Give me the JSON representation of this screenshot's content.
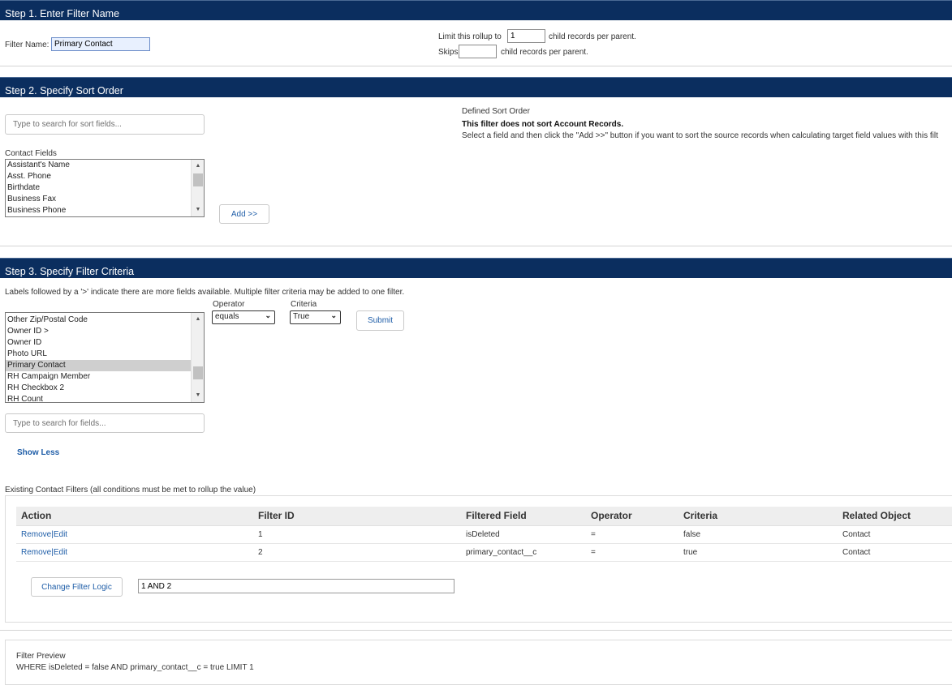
{
  "step1": {
    "title": "Step 1. Enter Filter Name",
    "filter_name_label": "Filter Name:",
    "filter_name_value": "Primary Contact",
    "limit_label": "Limit this rollup to",
    "limit_value": "1",
    "limit_suffix": "child records per parent.",
    "skips_label": "Skips",
    "skips_value": "",
    "skips_suffix": "child records per parent."
  },
  "step2": {
    "title": "Step 2. Specify Sort Order",
    "search_placeholder": "Type to search for sort fields...",
    "list_label": "Contact Fields",
    "fields": [
      "Assistant's Name",
      "Asst. Phone",
      "Birthdate",
      "Business Fax",
      "Business Phone"
    ],
    "add_button": "Add >>",
    "defined_sort_label": "Defined Sort Order",
    "no_sort_msg": "This filter does not sort Account Records.",
    "instructions": "Select a field and then click the \"Add >>\" button if you want to sort the source records when calculating target field values with this filt"
  },
  "step3": {
    "title": "Step 3. Specify Filter Criteria",
    "note": "Labels followed by a '>' indicate there are more fields available. Multiple filter criteria may be added to one filter.",
    "fields": [
      "Other Zip/Postal Code",
      "Owner ID >",
      "Owner ID",
      "Photo URL",
      "Primary Contact",
      "RH Campaign Member",
      "RH Checkbox 2",
      "RH Count"
    ],
    "selected_field": "Primary Contact",
    "operator_label": "Operator",
    "operator_value": "equals",
    "criteria_label": "Criteria",
    "criteria_value": "True",
    "submit_button": "Submit",
    "search_placeholder": "Type to search for fields...",
    "show_less": "Show Less",
    "existing_label": "Existing Contact Filters (all conditions must be met to rollup the value)",
    "table": {
      "columns": [
        "Action",
        "Filter ID",
        "Filtered Field",
        "Operator",
        "Criteria",
        "Related Object"
      ],
      "rows": [
        {
          "action": "Remove|Edit",
          "id": "1",
          "field": "isDeleted",
          "operator": "=",
          "criteria": "false",
          "object": "Contact"
        },
        {
          "action": "Remove|Edit",
          "id": "2",
          "field": "primary_contact__c",
          "operator": "=",
          "criteria": "true",
          "object": "Contact"
        }
      ]
    },
    "change_logic_button": "Change Filter Logic",
    "logic_value": "1 AND 2"
  },
  "preview": {
    "label": "Filter Preview",
    "query": "WHERE isDeleted = false AND primary_contact__c = true LIMIT 1"
  },
  "colors": {
    "header_bg": "#0b2e5f",
    "link": "#1f5ea8",
    "selected_row": "#cfcfcf"
  }
}
